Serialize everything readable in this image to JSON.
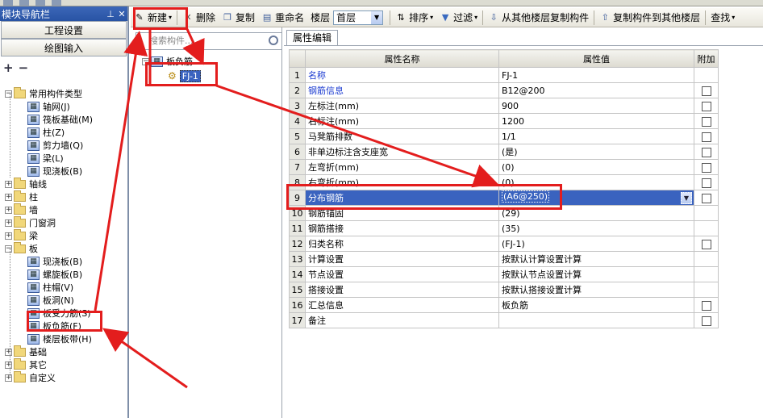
{
  "nav": {
    "title": "模块导航栏",
    "pin": "⊥",
    "close": "✕",
    "buttons": [
      "工程设置",
      "绘图输入"
    ],
    "tree": [
      {
        "label": "常用构件类型",
        "kind": "folder",
        "level": 0,
        "expanded": true
      },
      {
        "label": "轴网(J)",
        "kind": "item",
        "level": 1
      },
      {
        "label": "筏板基础(M)",
        "kind": "item",
        "level": 1
      },
      {
        "label": "柱(Z)",
        "kind": "item",
        "level": 1
      },
      {
        "label": "剪力墙(Q)",
        "kind": "item",
        "level": 1
      },
      {
        "label": "梁(L)",
        "kind": "item",
        "level": 1
      },
      {
        "label": "现浇板(B)",
        "kind": "item",
        "level": 1
      },
      {
        "label": "轴线",
        "kind": "folder",
        "level": 0,
        "expanded": false
      },
      {
        "label": "柱",
        "kind": "folder",
        "level": 0,
        "expanded": false
      },
      {
        "label": "墙",
        "kind": "folder",
        "level": 0,
        "expanded": false
      },
      {
        "label": "门窗洞",
        "kind": "folder",
        "level": 0,
        "expanded": false
      },
      {
        "label": "梁",
        "kind": "folder",
        "level": 0,
        "expanded": false
      },
      {
        "label": "板",
        "kind": "folder",
        "level": 0,
        "expanded": true
      },
      {
        "label": "现浇板(B)",
        "kind": "item",
        "level": 1
      },
      {
        "label": "螺旋板(B)",
        "kind": "item",
        "level": 1
      },
      {
        "label": "柱帽(V)",
        "kind": "item",
        "level": 1
      },
      {
        "label": "板洞(N)",
        "kind": "item",
        "level": 1
      },
      {
        "label": "板受力筋(S)",
        "kind": "item",
        "level": 1
      },
      {
        "label": "板负筋(F)",
        "kind": "item",
        "level": 1
      },
      {
        "label": "楼层板带(H)",
        "kind": "item",
        "level": 1
      },
      {
        "label": "基础",
        "kind": "folder",
        "level": 0,
        "expanded": false
      },
      {
        "label": "其它",
        "kind": "folder",
        "level": 0,
        "expanded": false
      },
      {
        "label": "自定义",
        "kind": "folder",
        "level": 0,
        "expanded": false
      }
    ]
  },
  "toolbar": {
    "new": "新建",
    "delete": "删除",
    "copy": "复制",
    "rename": "重命名",
    "floor_label": "楼层",
    "floor_value": "首层",
    "sort": "排序",
    "filter": "过滤",
    "copy_from": "从其他楼层复制构件",
    "copy_to": "复制构件到其他楼层",
    "find": "查找"
  },
  "middle": {
    "search_placeholder": "搜索构件...",
    "tree_root": "板负筋",
    "tree_child": "FJ-1"
  },
  "props": {
    "tab": "属性编辑",
    "headers": [
      "属性名称",
      "属性值",
      "附加"
    ],
    "rows": [
      {
        "n": "1",
        "name": "名称",
        "value": "FJ-1",
        "blue": true,
        "cb": false
      },
      {
        "n": "2",
        "name": "钢筋信息",
        "value": "B12@200",
        "blue": true,
        "cb": true
      },
      {
        "n": "3",
        "name": "左标注(mm)",
        "value": "900",
        "blue": false,
        "cb": true
      },
      {
        "n": "4",
        "name": "右标注(mm)",
        "value": "1200",
        "blue": false,
        "cb": true
      },
      {
        "n": "5",
        "name": "马凳筋排数",
        "value": "1/1",
        "blue": false,
        "cb": true
      },
      {
        "n": "6",
        "name": "非单边标注含支座宽",
        "value": "(是)",
        "blue": false,
        "cb": true
      },
      {
        "n": "7",
        "name": "左弯折(mm)",
        "value": "(0)",
        "blue": false,
        "cb": true
      },
      {
        "n": "8",
        "name": "右弯折(mm)",
        "value": "(0)",
        "blue": false,
        "cb": true
      },
      {
        "n": "9",
        "name": "分布钢筋",
        "value": "(A6@250)",
        "blue": false,
        "cb": true
      },
      {
        "n": "10",
        "name": "钢筋锚固",
        "value": "(29)",
        "blue": false,
        "cb": false
      },
      {
        "n": "11",
        "name": "钢筋搭接",
        "value": "(35)",
        "blue": false,
        "cb": false
      },
      {
        "n": "12",
        "name": "归类名称",
        "value": "(FJ-1)",
        "blue": false,
        "cb": true
      },
      {
        "n": "13",
        "name": "计算设置",
        "value": "按默认计算设置计算",
        "blue": false,
        "cb": false
      },
      {
        "n": "14",
        "name": "节点设置",
        "value": "按默认节点设置计算",
        "blue": false,
        "cb": false
      },
      {
        "n": "15",
        "name": "搭接设置",
        "value": "按默认搭接设置计算",
        "blue": false,
        "cb": false
      },
      {
        "n": "16",
        "name": "汇总信息",
        "value": "板负筋",
        "blue": false,
        "cb": true
      },
      {
        "n": "17",
        "name": "备注",
        "value": "",
        "blue": false,
        "cb": true
      }
    ],
    "selected_row": 9
  },
  "colors": {
    "annotation": "#e31d1d",
    "selection": "#3a63bf"
  }
}
